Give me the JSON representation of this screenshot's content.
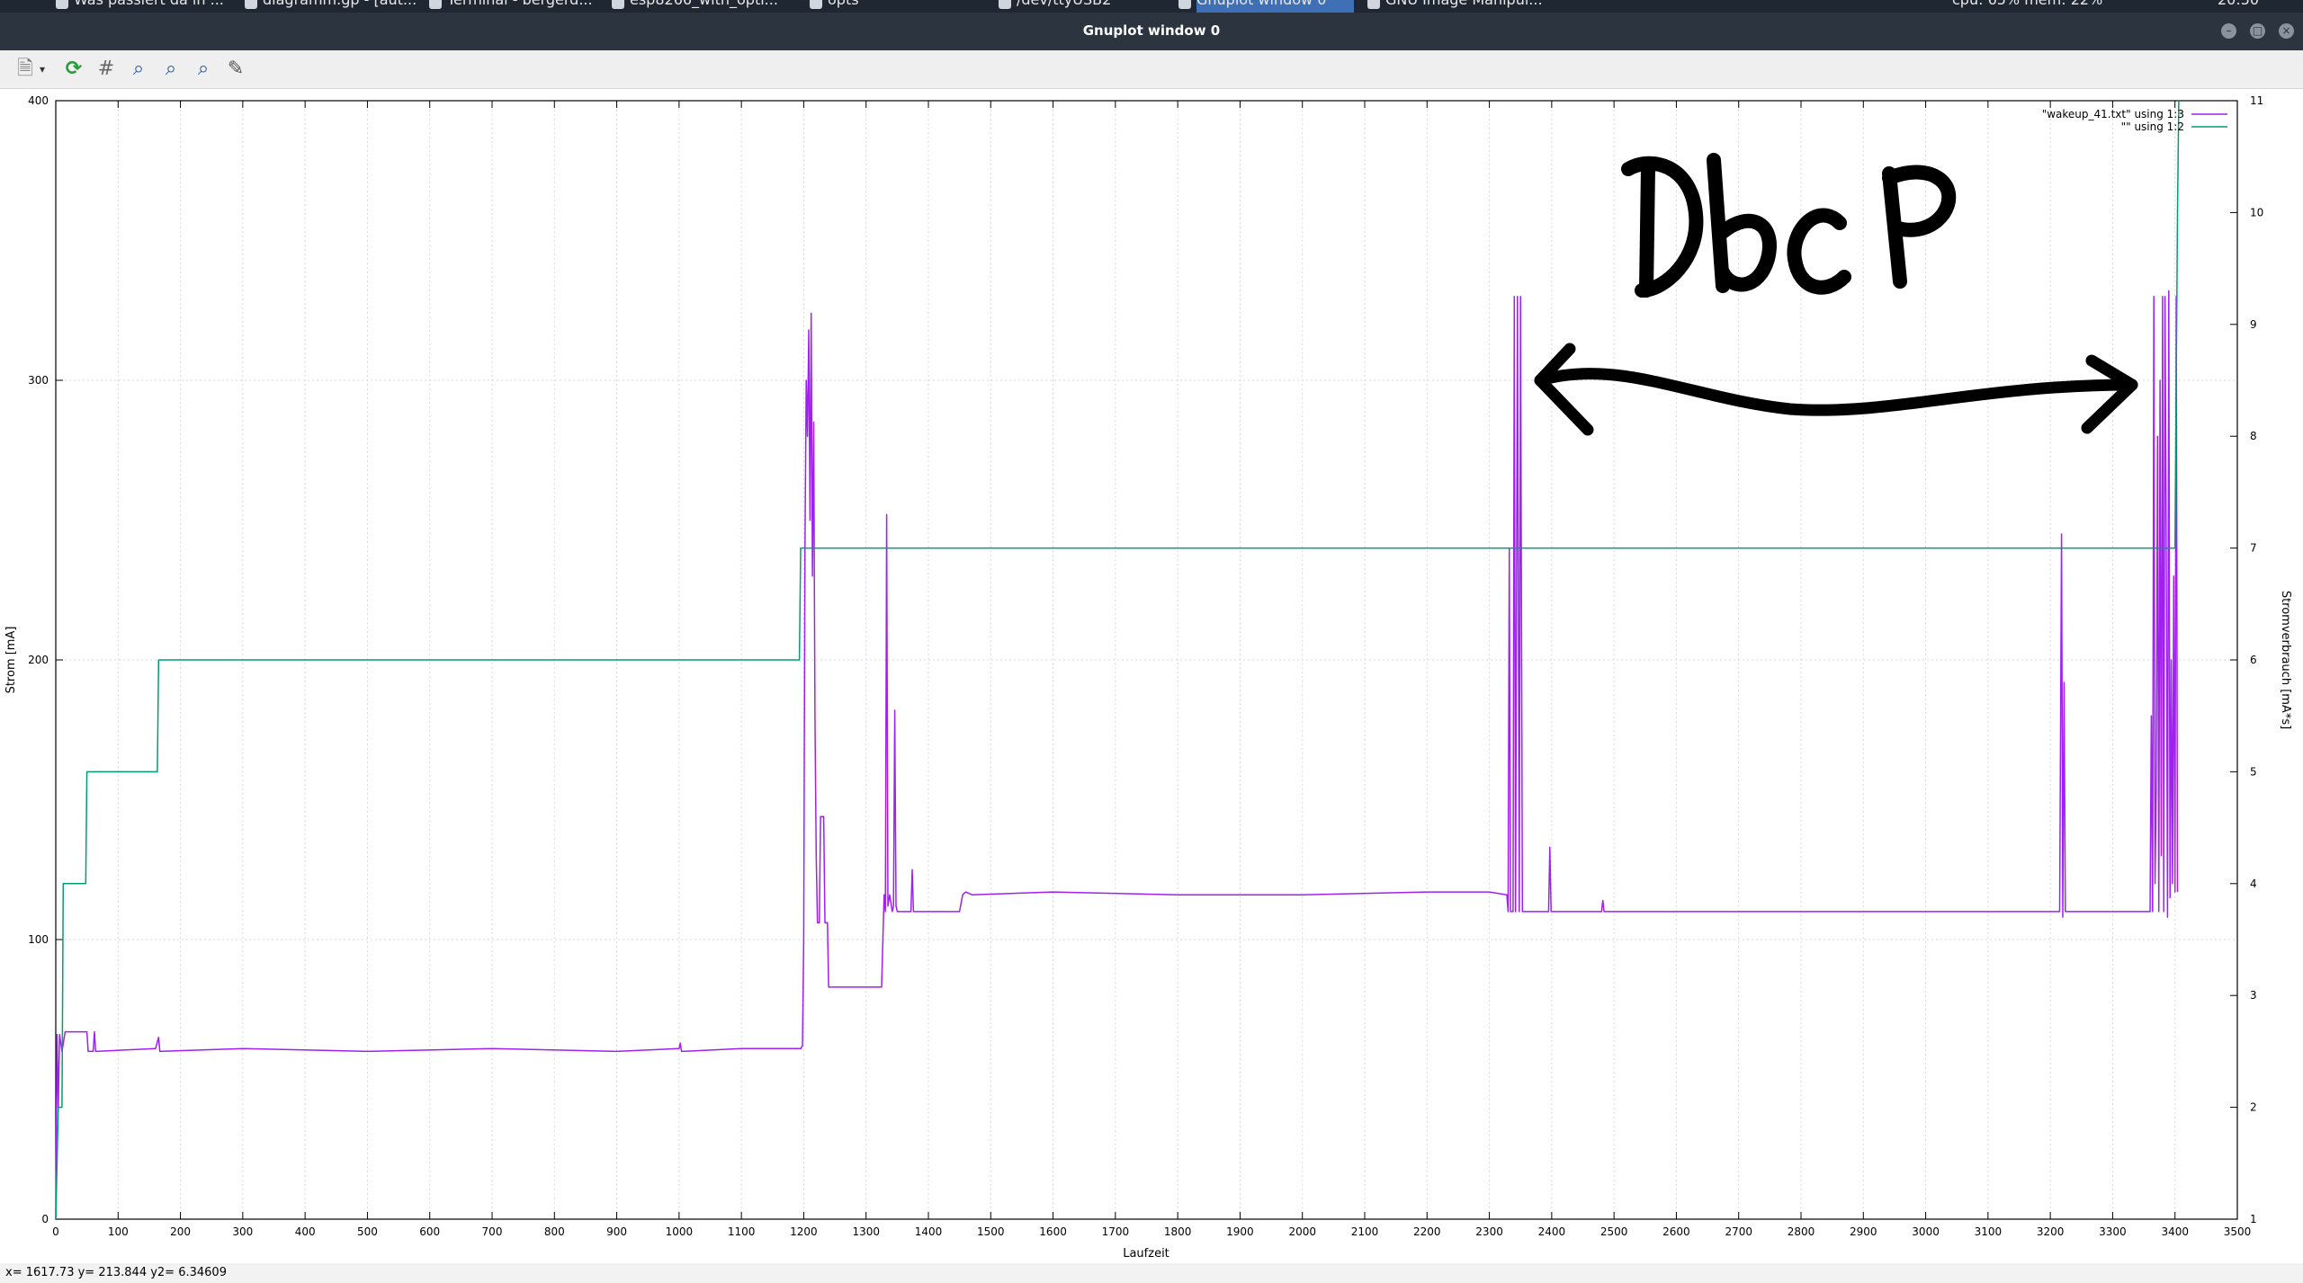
{
  "taskbar": {
    "tabs": [
      {
        "label": "Was passiert da in ..."
      },
      {
        "label": "diagramm.gp - [aut..."
      },
      {
        "label": "Terminal - bergerd..."
      },
      {
        "label": "esp8266_with_opti..."
      },
      {
        "label": "opts"
      },
      {
        "label": "/dev/ttyUSB2"
      },
      {
        "label": "Gnuplot window 0"
      },
      {
        "label": "GNU Image Manipul..."
      }
    ],
    "tray": "cpu: 65% mem: 22%",
    "clock": "20:50"
  },
  "window": {
    "title": "Gnuplot window 0"
  },
  "status": {
    "text": "x= 1617.73 y= 213.844 y2= 6.34609"
  },
  "annotation": {
    "text": "DbC P"
  },
  "colors": {
    "series1": "#a020f0",
    "series2": "#009e73",
    "grid": "#d9d9d9",
    "annotation": "#000000"
  },
  "chart_data": {
    "type": "line",
    "xlabel": "Laufzeit",
    "ylabel": "Strom [mA]",
    "y2label": "Stromverbrauch [mA*s]",
    "xlim": [
      0,
      3500
    ],
    "ylim": [
      0,
      400
    ],
    "y2lim": [
      1,
      11
    ],
    "xticks": [
      0,
      100,
      200,
      300,
      400,
      500,
      600,
      700,
      800,
      900,
      1000,
      1100,
      1200,
      1300,
      1400,
      1500,
      1600,
      1700,
      1800,
      1900,
      2000,
      2100,
      2200,
      2300,
      2400,
      2500,
      2600,
      2700,
      2800,
      2900,
      3000,
      3100,
      3200,
      3300,
      3400,
      3500
    ],
    "yticks": [
      0,
      100,
      200,
      300,
      400
    ],
    "y2ticks": [
      1,
      2,
      3,
      4,
      5,
      6,
      7,
      8,
      9,
      10,
      11
    ],
    "grid": true,
    "legend_position": "top-right",
    "series": [
      {
        "name": "\"wakeup_41.txt\" using 1:3",
        "axis": "y",
        "points": [
          [
            0,
            0
          ],
          [
            2,
            66
          ],
          [
            4,
            40
          ],
          [
            6,
            66
          ],
          [
            10,
            60
          ],
          [
            15,
            67
          ],
          [
            50,
            67
          ],
          [
            52,
            60
          ],
          [
            60,
            60
          ],
          [
            62,
            67
          ],
          [
            64,
            60
          ],
          [
            160,
            61
          ],
          [
            165,
            65
          ],
          [
            167,
            60
          ],
          [
            300,
            61
          ],
          [
            500,
            60
          ],
          [
            700,
            61
          ],
          [
            900,
            60
          ],
          [
            1000,
            61
          ],
          [
            1002,
            63
          ],
          [
            1004,
            60
          ],
          [
            1100,
            61
          ],
          [
            1195,
            61
          ],
          [
            1198,
            62
          ],
          [
            1200,
            100
          ],
          [
            1202,
            240
          ],
          [
            1204,
            300
          ],
          [
            1206,
            280
          ],
          [
            1208,
            318
          ],
          [
            1210,
            250
          ],
          [
            1212,
            324
          ],
          [
            1214,
            230
          ],
          [
            1216,
            285
          ],
          [
            1218,
            180
          ],
          [
            1220,
            130
          ],
          [
            1222,
            106
          ],
          [
            1225,
            106
          ],
          [
            1227,
            144
          ],
          [
            1232,
            144
          ],
          [
            1234,
            106
          ],
          [
            1238,
            106
          ],
          [
            1240,
            83
          ],
          [
            1320,
            83
          ],
          [
            1325,
            83
          ],
          [
            1327,
            100
          ],
          [
            1329,
            116
          ],
          [
            1331,
            110
          ],
          [
            1333,
            252
          ],
          [
            1335,
            112
          ],
          [
            1338,
            116
          ],
          [
            1342,
            110
          ],
          [
            1344,
            112
          ],
          [
            1346,
            182
          ],
          [
            1348,
            112
          ],
          [
            1350,
            110
          ],
          [
            1372,
            110
          ],
          [
            1374,
            125
          ],
          [
            1376,
            110
          ],
          [
            1450,
            110
          ],
          [
            1455,
            116
          ],
          [
            1460,
            117
          ],
          [
            1470,
            116
          ],
          [
            1600,
            117
          ],
          [
            1800,
            116
          ],
          [
            2000,
            116
          ],
          [
            2200,
            117
          ],
          [
            2300,
            117
          ],
          [
            2328,
            116
          ],
          [
            2330,
            110
          ],
          [
            2332,
            240
          ],
          [
            2334,
            110
          ],
          [
            2338,
            110
          ],
          [
            2340,
            330
          ],
          [
            2342,
            110
          ],
          [
            2345,
            330
          ],
          [
            2348,
            110
          ],
          [
            2350,
            330
          ],
          [
            2353,
            110
          ],
          [
            2355,
            110
          ],
          [
            2395,
            110
          ],
          [
            2397,
            133
          ],
          [
            2399,
            110
          ],
          [
            2480,
            110
          ],
          [
            2482,
            114
          ],
          [
            2484,
            110
          ],
          [
            2600,
            110
          ],
          [
            2800,
            110
          ],
          [
            3000,
            110
          ],
          [
            3200,
            110
          ],
          [
            3215,
            110
          ],
          [
            3218,
            245
          ],
          [
            3220,
            108
          ],
          [
            3222,
            192
          ],
          [
            3224,
            110
          ],
          [
            3340,
            110
          ],
          [
            3345,
            110
          ],
          [
            3360,
            110
          ],
          [
            3362,
            180
          ],
          [
            3364,
            110
          ],
          [
            3366,
            330
          ],
          [
            3368,
            120
          ],
          [
            3370,
            155
          ],
          [
            3372,
            280
          ],
          [
            3374,
            110
          ],
          [
            3376,
            300
          ],
          [
            3378,
            130
          ],
          [
            3380,
            330
          ],
          [
            3382,
            110
          ],
          [
            3384,
            330
          ],
          [
            3386,
            240
          ],
          [
            3388,
            108
          ],
          [
            3390,
            332
          ],
          [
            3392,
            115
          ],
          [
            3394,
            200
          ],
          [
            3396,
            120
          ],
          [
            3398,
            230
          ],
          [
            3400,
            117
          ],
          [
            3402,
            330
          ],
          [
            3404,
            117
          ]
        ]
      },
      {
        "name": "\"\" using 1:2",
        "axis": "y2",
        "points": [
          [
            0,
            1
          ],
          [
            4,
            2
          ],
          [
            10,
            2
          ],
          [
            12,
            4
          ],
          [
            48,
            4
          ],
          [
            50,
            5
          ],
          [
            163,
            5
          ],
          [
            165,
            6
          ],
          [
            1193,
            6
          ],
          [
            1195,
            7
          ],
          [
            3380,
            7
          ],
          [
            3400,
            7
          ],
          [
            3404,
            10
          ],
          [
            3406,
            11
          ]
        ]
      }
    ]
  }
}
